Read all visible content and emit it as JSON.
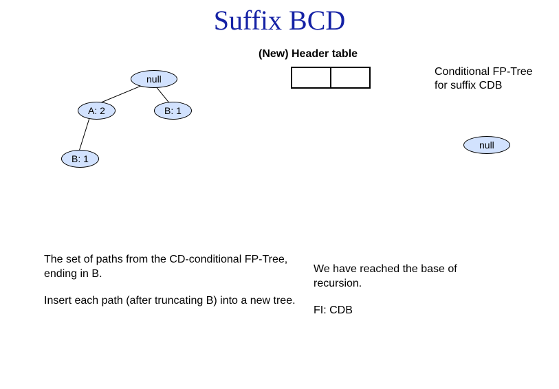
{
  "title": "Suffix BCD",
  "header_table_label": "(New) Header table",
  "tree": {
    "root": "null",
    "a2": "A: 2",
    "b1_right": "B: 1",
    "b1_bottom": "B: 1"
  },
  "conditional_label": "Conditional FP-Tree for suffix CDB",
  "cond_tree": {
    "root": "null"
  },
  "left_text": {
    "p1": "The set of paths from the CD-conditional FP-Tree, ending in B.",
    "p2": "Insert each path (after truncating B) into a new tree."
  },
  "right_text": {
    "p1": "We have reached the base of recursion.",
    "p2": "FI: CDB"
  }
}
